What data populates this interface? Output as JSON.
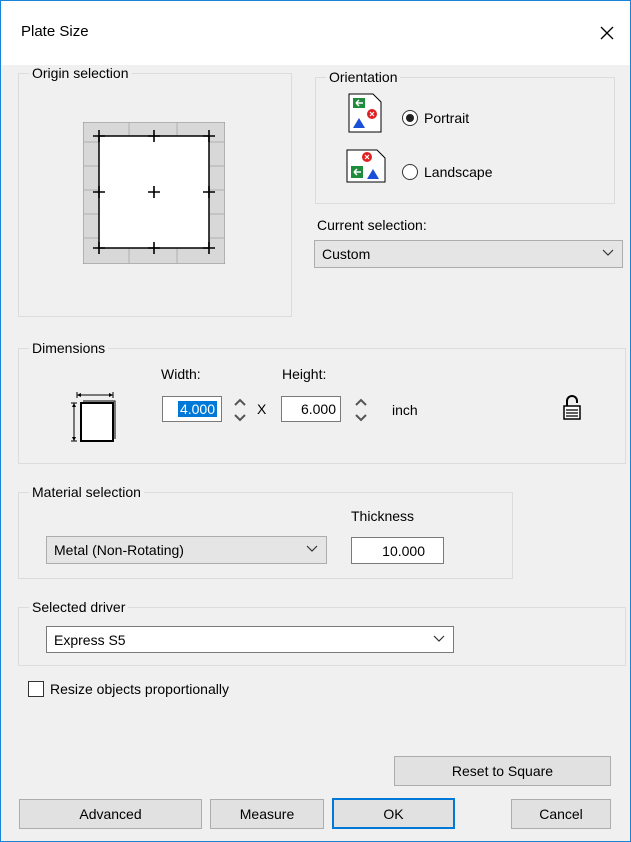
{
  "window": {
    "title": "Plate Size"
  },
  "origin": {
    "legend": "Origin selection"
  },
  "orientation": {
    "legend": "Orientation",
    "portrait_label": "Portrait",
    "landscape_label": "Landscape",
    "selected": "Portrait"
  },
  "current_selection": {
    "label": "Current selection:",
    "value": "Custom"
  },
  "dimensions": {
    "legend": "Dimensions",
    "width_label": "Width:",
    "height_label": "Height:",
    "width_value": "4.000",
    "height_value": "6.000",
    "times_symbol": "X",
    "unit": "inch"
  },
  "material": {
    "legend": "Material selection",
    "value": "Metal (Non-Rotating)",
    "thickness_label": "Thickness",
    "thickness_value": "10.000"
  },
  "driver": {
    "legend": "Selected driver",
    "value": "Express S5"
  },
  "resize": {
    "label": "Resize objects proportionally",
    "checked": false
  },
  "buttons": {
    "reset": "Reset to Square",
    "advanced": "Advanced",
    "measure": "Measure",
    "ok": "OK",
    "cancel": "Cancel"
  },
  "colors": {
    "accent": "#0078d7",
    "selection": "#0078d7",
    "icon_green": "#1e8c3a",
    "icon_red": "#e02020",
    "icon_blue": "#1a4fd8"
  }
}
